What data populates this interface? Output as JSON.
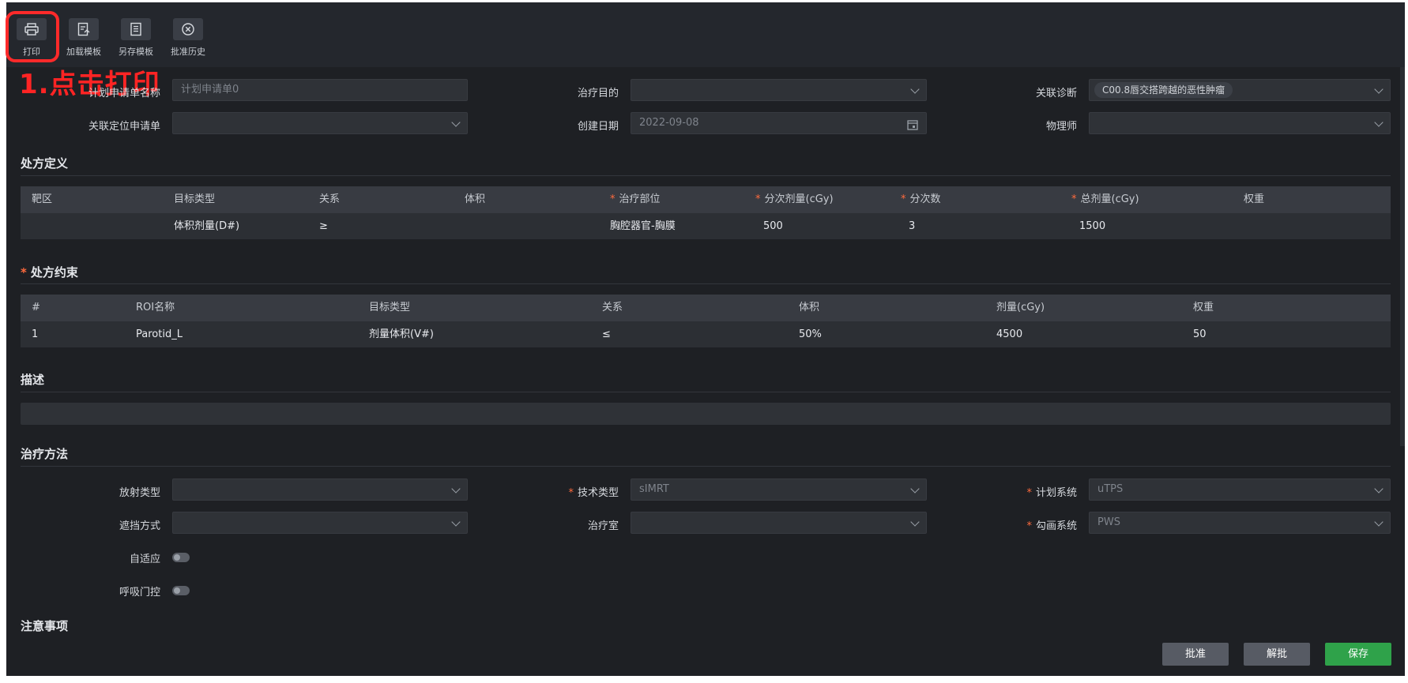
{
  "toolbar": {
    "print_label": "打印",
    "load_template_label": "加载模板",
    "save_template_label": "另存模板",
    "approval_history_label": "批准历史"
  },
  "annotation": "1.点击打印",
  "form": {
    "plan_request_name_label": "计划申请单名称",
    "plan_request_name_placeholder": "计划申请单0",
    "treatment_purpose_label": "治疗目的",
    "treatment_purpose_value": "",
    "linked_diagnosis_label": "关联诊断",
    "linked_diagnosis_tag": "C00.8唇交搭跨越的恶性肿瘤",
    "linked_location_request_label": "关联定位申请单",
    "creation_date_label": "创建日期",
    "creation_date_value": "2022-09-08",
    "physicist_label": "物理师"
  },
  "prescription_definition": {
    "title": "处方定义",
    "headers": [
      "靶区",
      "目标类型",
      "关系",
      "体积",
      "治疗部位",
      "分次剂量(cGy)",
      "分次数",
      "总剂量(cGy)",
      "权重"
    ],
    "required": [
      false,
      false,
      false,
      false,
      true,
      true,
      true,
      true,
      false
    ],
    "rows": [
      [
        "",
        "体积剂量(D#)",
        "≥",
        "",
        "胸腔器官-胸膜",
        "500",
        "3",
        "1500",
        ""
      ]
    ]
  },
  "prescription_constraints": {
    "title": "处方约束",
    "headers": [
      "#",
      "ROI名称",
      "目标类型",
      "关系",
      "体积",
      "剂量(cGy)",
      "权重"
    ],
    "rows": [
      [
        "1",
        "Parotid_L",
        "剂量体积(V#)",
        "≤",
        "50%",
        "4500",
        "50"
      ]
    ]
  },
  "description": {
    "title": "描述",
    "value": ""
  },
  "treatment_method": {
    "title": "治疗方法",
    "radiation_type_label": "放射类型",
    "technique_type_label": "技术类型",
    "technique_type_value": "sIMRT",
    "planning_system_label": "计划系统",
    "planning_system_value": "uTPS",
    "shielding_label": "遮挡方式",
    "treatment_room_label": "治疗室",
    "contouring_system_label": "勾画系统",
    "contouring_system_value": "PWS",
    "adaptive_label": "自适应",
    "breath_gating_label": "呼吸门控"
  },
  "notes": {
    "title": "注意事项"
  },
  "buttons": {
    "approve": "批准",
    "unapprove": "解批",
    "save": "保存"
  },
  "colors": {
    "accent_required": "#ff6a3d",
    "save_green": "#2fa24a",
    "annotation_red": "#ff2424"
  }
}
